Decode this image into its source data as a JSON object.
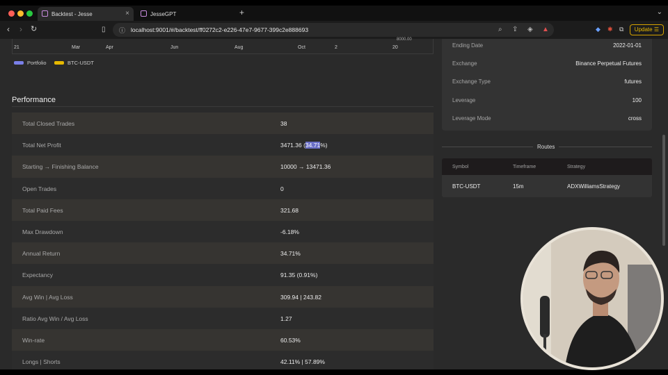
{
  "browser": {
    "tabs": [
      {
        "title": "Backtest - Jesse",
        "active": true
      },
      {
        "title": "JesseGPT",
        "active": false
      }
    ],
    "url": "localhost:9001/#/backtest/ff0272c2-e226-47e7-9677-399c2e888693",
    "update_label": "Update",
    "extension_badge": "1"
  },
  "chart": {
    "x_ticks": [
      "21",
      "Mar",
      "Apr",
      "Jun",
      "Aug",
      "Oct",
      "2",
      "20"
    ],
    "y_tick_partial": "8000.00",
    "legend": [
      {
        "label": "Portfolio",
        "color": "#7a7fe8"
      },
      {
        "label": "BTC-USDT",
        "color": "#e6b800"
      }
    ]
  },
  "performance": {
    "title": "Performance",
    "rows": [
      {
        "label": "Total Closed Trades",
        "value": "38"
      },
      {
        "label": "Total Net Profit",
        "value_pre": "3471.36 (",
        "value_hl": "34.71",
        "value_post": "%)"
      },
      {
        "label": "Starting → Finishing Balance",
        "value": "10000 → 13471.36"
      },
      {
        "label": "Open Trades",
        "value": "0"
      },
      {
        "label": "Total Paid Fees",
        "value": "321.68"
      },
      {
        "label": "Max Drawdown",
        "value": "-6.18%"
      },
      {
        "label": "Annual Return",
        "value": "34.71%"
      },
      {
        "label": "Expectancy",
        "value": "91.35 (0.91%)"
      },
      {
        "label": "Avg Win | Avg Loss",
        "value": "309.94 | 243.82"
      },
      {
        "label": "Ratio Avg Win / Avg Loss",
        "value": "1.27"
      },
      {
        "label": "Win-rate",
        "value": "60.53%"
      },
      {
        "label": "Longs | Shorts",
        "value": "42.11% | 57.89%"
      }
    ]
  },
  "info": {
    "rows": [
      {
        "label": "Ending Date",
        "value": "2022-01-01"
      },
      {
        "label": "Exchange",
        "value": "Binance Perpetual Futures"
      },
      {
        "label": "Exchange Type",
        "value": "futures"
      },
      {
        "label": "Leverage",
        "value": "100"
      },
      {
        "label": "Leverage Mode",
        "value": "cross"
      }
    ]
  },
  "routes": {
    "title": "Routes",
    "headers": [
      "Symbol",
      "Timeframe",
      "Strategy"
    ],
    "rows": [
      [
        "BTC-USDT",
        "15m",
        "ADXWilliamsStrategy"
      ]
    ]
  }
}
